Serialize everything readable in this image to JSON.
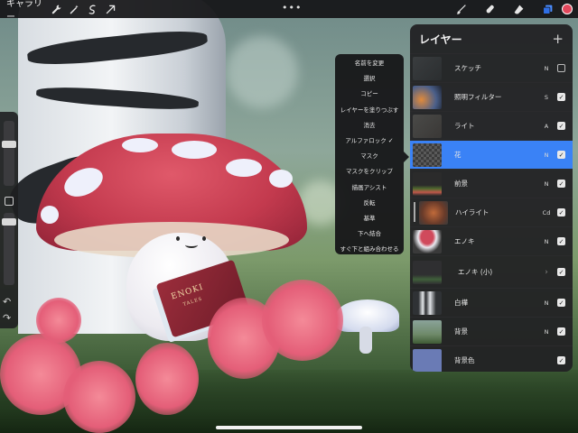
{
  "toolbar": {
    "gallery_label": "ギャラリー",
    "center_dots": "•••",
    "left_icons": [
      "wrench-icon",
      "magic-wand-icon",
      "selection-icon",
      "transform-arrow-icon"
    ],
    "right_icons": [
      "brush-icon",
      "smudge-icon",
      "eraser-icon",
      "layers-icon"
    ],
    "active_color": "#e2475c"
  },
  "sidebar": {
    "undo_symbol": "↶",
    "redo_symbol": "↷"
  },
  "context_menu": {
    "items": [
      {
        "label": "名前を変更"
      },
      {
        "label": "選択"
      },
      {
        "label": "コピー"
      },
      {
        "label": "レイヤーを塗りつぶす"
      },
      {
        "label": "消去"
      },
      {
        "label": "アルファロック",
        "checked_symbol": "✓"
      },
      {
        "label": "マスク"
      },
      {
        "label": "マスクをクリップ"
      },
      {
        "label": "描画アシスト"
      },
      {
        "label": "反転"
      },
      {
        "label": "基準"
      },
      {
        "label": "下へ結合"
      },
      {
        "label": "すぐ下と組み合わせる"
      }
    ]
  },
  "layers_panel": {
    "title": "レイヤー",
    "add_symbol": "+",
    "layers": [
      {
        "name": "スケッチ",
        "blend": "N",
        "visible": false,
        "check": ""
      },
      {
        "name": "照明フィルター",
        "blend": "S",
        "visible": true,
        "check": "✓"
      },
      {
        "name": "ライト",
        "blend": "A",
        "visible": true,
        "check": "✓"
      },
      {
        "name": "花",
        "blend": "N",
        "visible": true,
        "check": "✓",
        "selected": true
      },
      {
        "name": "前景",
        "blend": "N",
        "visible": true,
        "check": "✓"
      },
      {
        "name": "ハイライト",
        "blend": "Cd",
        "visible": true,
        "check": "✓"
      },
      {
        "name": "エノキ",
        "blend": "N",
        "visible": true,
        "check": "✓"
      },
      {
        "name": "エノキ (小)",
        "blend": "›",
        "visible": true,
        "check": "✓"
      },
      {
        "name": "白樺",
        "blend": "N",
        "visible": true,
        "check": "✓"
      },
      {
        "name": "背景",
        "blend": "N",
        "visible": true,
        "check": "✓"
      },
      {
        "name": "背景色",
        "blend": "",
        "visible": true,
        "check": "✓"
      }
    ]
  },
  "artwork": {
    "book_title": "ENOKI",
    "book_subtitle": "TALES"
  }
}
